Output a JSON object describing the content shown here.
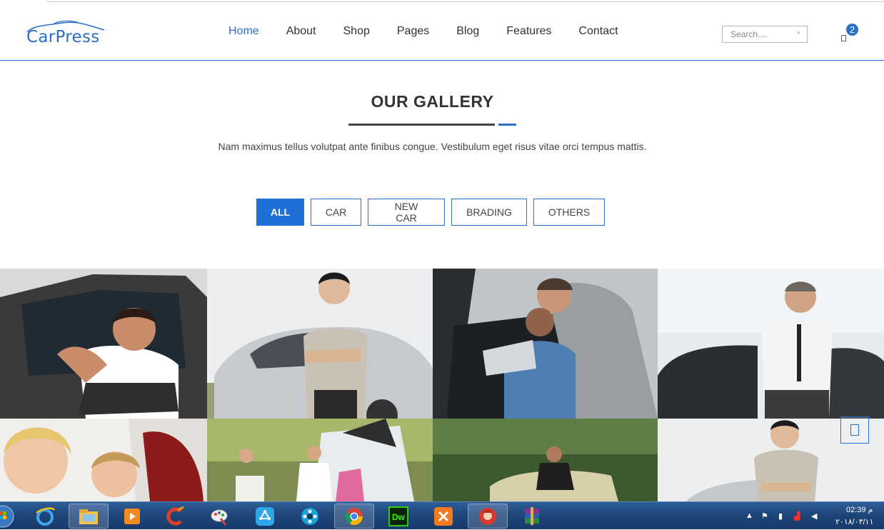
{
  "brand": {
    "logo_text": "CarPress",
    "accent_color": "#2c6fc9"
  },
  "nav": {
    "items": [
      {
        "label": "Home",
        "active": true
      },
      {
        "label": "About",
        "active": false
      },
      {
        "label": "Shop",
        "active": false
      },
      {
        "label": "Pages",
        "active": false
      },
      {
        "label": "Blog",
        "active": false
      },
      {
        "label": "Features",
        "active": false
      },
      {
        "label": "Contact",
        "active": false
      }
    ]
  },
  "search": {
    "placeholder": "Search...."
  },
  "cart": {
    "count": "2"
  },
  "section": {
    "title": "OUR GALLERY",
    "description": "Nam maximus tellus volutpat ante finibus congue. Vestibulum eget risus vitae orci tempus mattis."
  },
  "filters": [
    {
      "label": "ALL",
      "active": true
    },
    {
      "label": "CAR",
      "active": false
    },
    {
      "label": "NEW CAR",
      "active": false
    },
    {
      "label": "BRADING",
      "active": false
    },
    {
      "label": "OTHERS",
      "active": false
    }
  ],
  "gallery": {
    "photos": [
      "man-in-car-holding-keys",
      "young-man-by-silver-car",
      "salesman-with-customer-in-car",
      "businessman-by-black-car",
      "woman-and-child",
      "family-loading-car-trunk",
      "man-sitting-on-old-car",
      "young-man-by-silver-car"
    ]
  },
  "taskbar": {
    "apps": [
      "start-orb-icon",
      "internet-explorer-icon",
      "file-explorer-icon",
      "media-player-icon",
      "ccleaner-icon",
      "paint-icon",
      "sync-icon",
      "video-player-icon",
      "chrome-icon",
      "dreamweaver-icon",
      "xampp-icon",
      "user-app-icon",
      "winrar-icon"
    ],
    "dreamweaver_label": "Dw",
    "time": "02:39 م",
    "date": "٢٠١٨/٠٣/١١"
  }
}
